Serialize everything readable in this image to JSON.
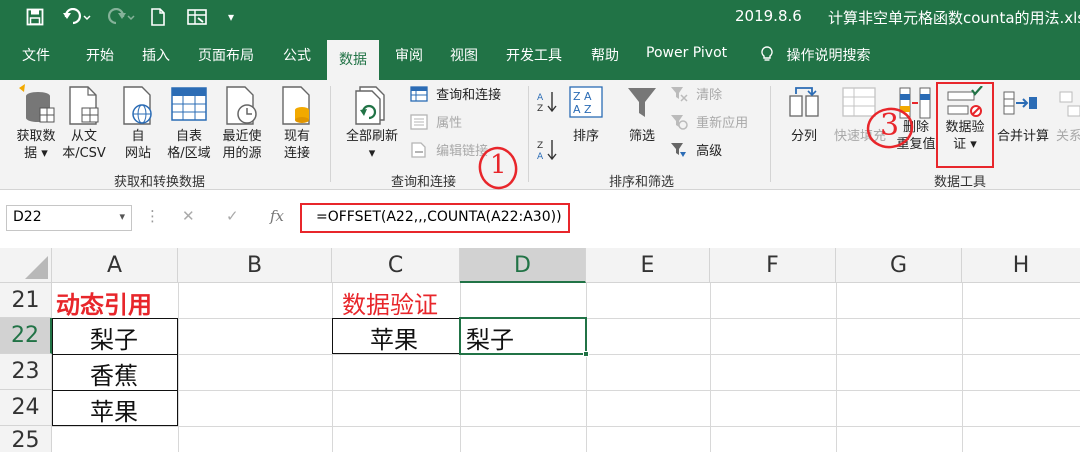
{
  "titlebar": {
    "date": "2019.8.6",
    "filename": "计算非空单元格函数counta的用法.xlsx"
  },
  "tabs": [
    "文件",
    "开始",
    "插入",
    "页面布局",
    "公式",
    "数据",
    "审阅",
    "视图",
    "开发工具",
    "帮助",
    "Power Pivot",
    "操作说明搜索"
  ],
  "active_tab": "数据",
  "ribbon": {
    "get_transform": {
      "get_data": [
        "获取数",
        "据 ▾"
      ],
      "from_text": [
        "从文",
        "本/CSV"
      ],
      "from_web": [
        "自",
        "网站"
      ],
      "from_table": [
        "自表",
        "格/区域"
      ],
      "recent": [
        "最近使",
        "用的源"
      ],
      "existing": [
        "现有",
        "连接"
      ],
      "group_label": "获取和转换数据"
    },
    "queries": {
      "refresh_all": [
        "全部刷新",
        "▾"
      ],
      "queries_connections": "查询和连接",
      "properties": "属性",
      "edit_links": "编辑链接",
      "group_label": "查询和连接"
    },
    "sort_filter": {
      "sort": "排序",
      "filter": "筛选",
      "clear": "清除",
      "reapply": "重新应用",
      "advanced": "高级",
      "group_label": "排序和筛选"
    },
    "data_tools": {
      "text_to_columns": "分列",
      "flash_fill": "快速填充",
      "remove_duplicates": [
        "删除",
        "重复值"
      ],
      "data_validation": [
        "数据验",
        "证 ▾"
      ],
      "consolidate": "合并计算",
      "relationships": "关系",
      "group_label": "数据工具"
    }
  },
  "annotations": {
    "mark1": "1",
    "mark3": "3"
  },
  "formula_bar": {
    "name_box": "D22",
    "formula": "=OFFSET(A22,,,COUNTA(A22:A30))"
  },
  "sheet": {
    "columns": [
      "A",
      "B",
      "C",
      "D",
      "E",
      "F",
      "G",
      "H"
    ],
    "rows": [
      "21",
      "22",
      "23",
      "24",
      "25"
    ],
    "cells": {
      "A21": "动态引用",
      "A22": "梨子",
      "A23": "香蕉",
      "A24": "苹果",
      "C21": "数据验证",
      "C22": "苹果",
      "D22": "梨子"
    }
  },
  "colors": {
    "excel_green": "#217346",
    "annotation_red": "#e8262b",
    "header_text_red": "#e8262b"
  }
}
